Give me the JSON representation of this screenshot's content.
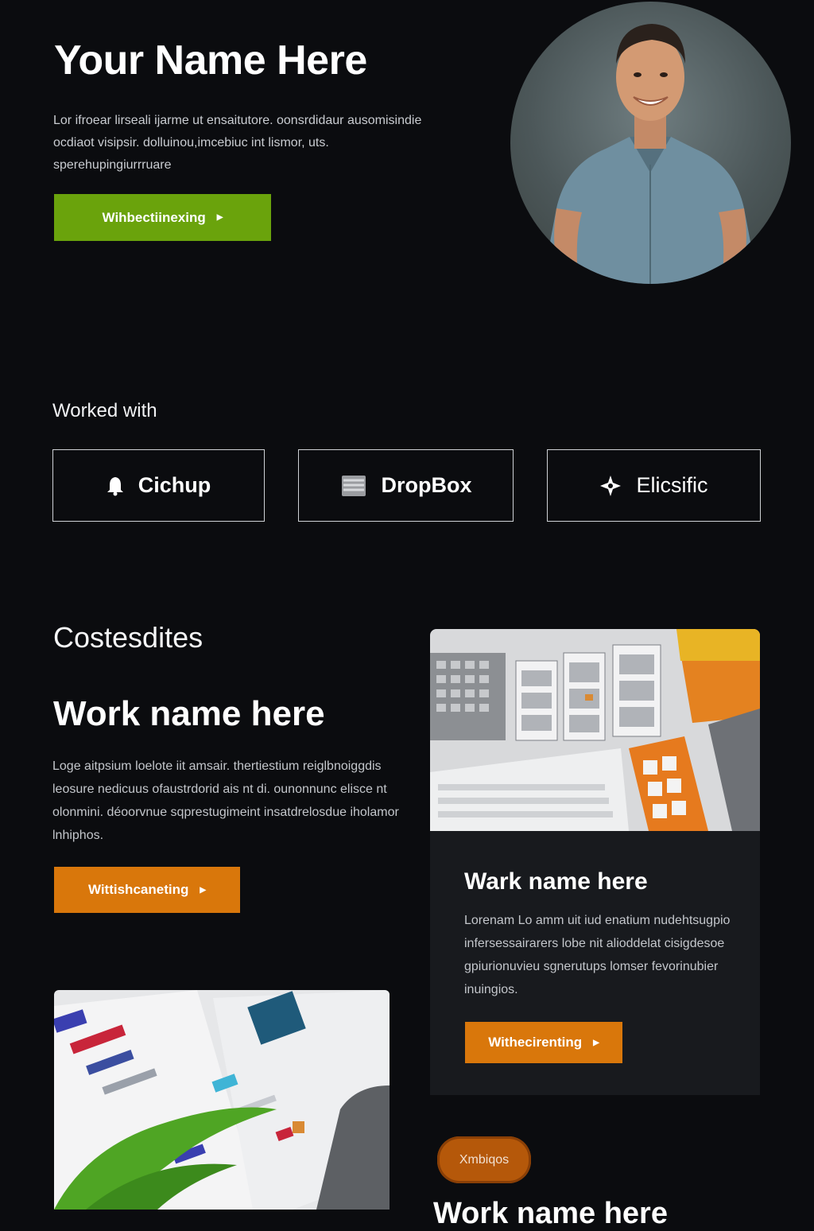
{
  "hero": {
    "title": "Your Name Here",
    "description": "Lor ifroear lirseali ijarme ut ensaitutore. oonsrdidaur ausomisindie ocdiaot visipsir. dolluinou,imcebiuc int lismor, uts. sperehupingiurrruare",
    "button_label": "Wihbectiinexing",
    "colors": {
      "button": "#6aa30c"
    }
  },
  "worked_with": {
    "label": "Worked with",
    "clients": [
      {
        "name": "Cichup",
        "icon": "bell-icon"
      },
      {
        "name": "DropBox",
        "icon": "box-icon"
      },
      {
        "name": "Elicsific",
        "icon": "star-icon"
      }
    ]
  },
  "case_studies": {
    "heading": "Costesdites",
    "feature": {
      "title": "Work name here",
      "description": "Loge aitpsium loelote iit amsair. thertiestium reiglbnoiggdis leosure nedicuus ofaustrdorid ais nt di. ounonnunc elisce nt olonmini. déoorvnue sqprestugimeint insatdrelosdue iholamor lnhiphos.",
      "button_label": "Wittishcaneting",
      "colors": {
        "button": "#d9770b"
      }
    },
    "card": {
      "title": "Wark name here",
      "description": "Lorenam Lo amm uit iud enatium nudehtsugpio infersessairarers lobe nit alioddelat cisigdesoe gpiurionuvieu sgnerutups lomser fevorinubier inuingios.",
      "button_label": "Withecirenting"
    },
    "tag_label": "Xmbiqos",
    "bottom_title": "Work name here"
  }
}
